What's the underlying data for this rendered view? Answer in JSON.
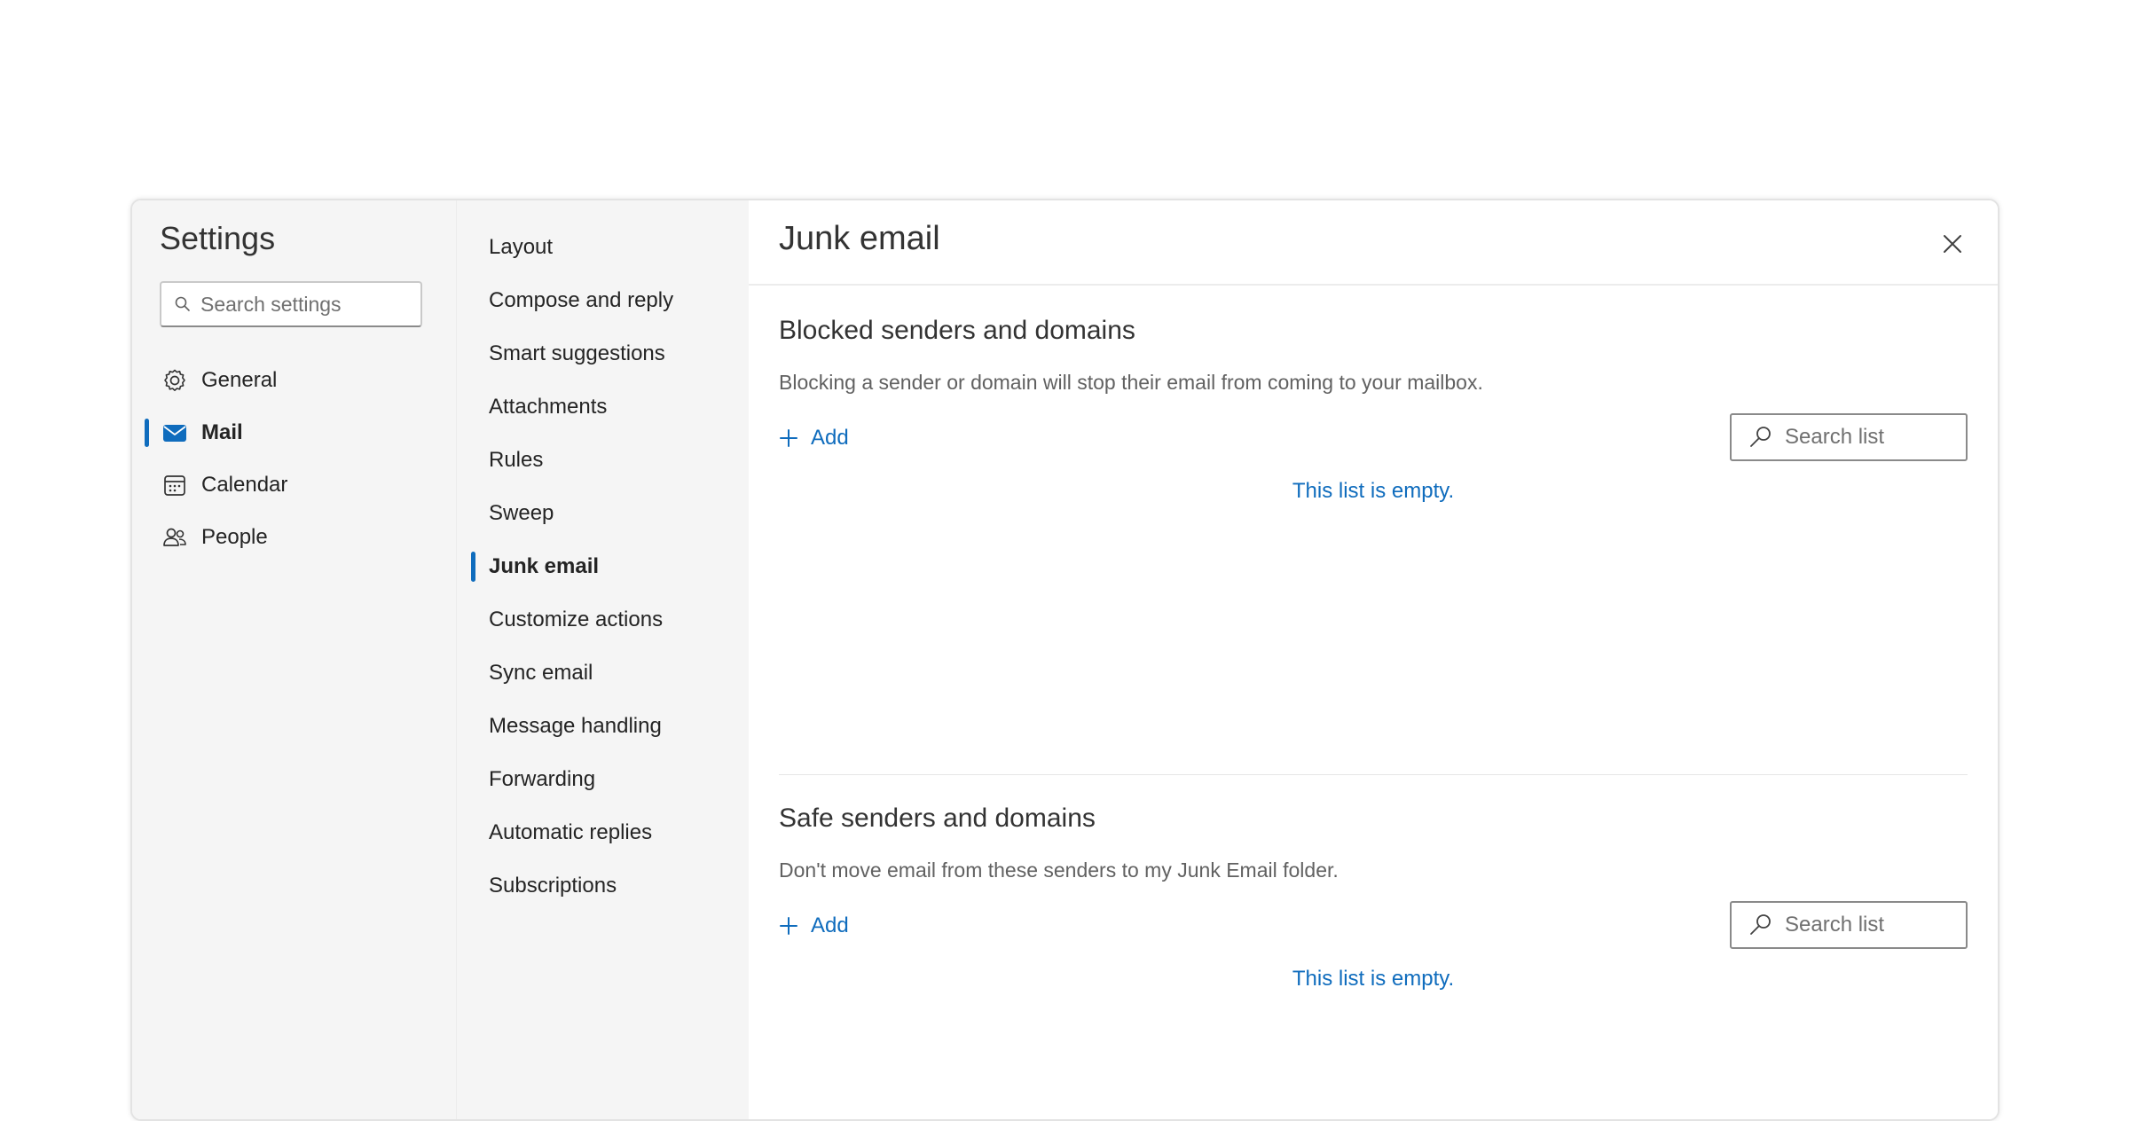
{
  "settings": {
    "title": "Settings",
    "search_placeholder": "Search settings"
  },
  "nav_primary": [
    {
      "label": "General",
      "icon": "gear-icon"
    },
    {
      "label": "Mail",
      "icon": "mail-icon",
      "active": true
    },
    {
      "label": "Calendar",
      "icon": "calendar-icon"
    },
    {
      "label": "People",
      "icon": "people-icon"
    }
  ],
  "nav_secondary": [
    {
      "label": "Layout"
    },
    {
      "label": "Compose and reply"
    },
    {
      "label": "Smart suggestions"
    },
    {
      "label": "Attachments"
    },
    {
      "label": "Rules"
    },
    {
      "label": "Sweep"
    },
    {
      "label": "Junk email",
      "active": true
    },
    {
      "label": "Customize actions"
    },
    {
      "label": "Sync email"
    },
    {
      "label": "Message handling"
    },
    {
      "label": "Forwarding"
    },
    {
      "label": "Automatic replies"
    },
    {
      "label": "Subscriptions"
    }
  ],
  "pane": {
    "title": "Junk email",
    "blocked": {
      "title": "Blocked senders and domains",
      "description": "Blocking a sender or domain will stop their email from coming to your mailbox.",
      "add_label": "Add",
      "search_placeholder": "Search list",
      "empty_text": "This list is empty."
    },
    "safe": {
      "title": "Safe senders and domains",
      "description": "Don't move email from these senders to my Junk Email folder.",
      "add_label": "Add",
      "search_placeholder": "Search list",
      "empty_text": "This list is empty."
    }
  },
  "colors": {
    "accent": "#0f6cbd",
    "nav_background": "#f5f5f5",
    "text": "#242424",
    "muted_text": "#616161"
  }
}
